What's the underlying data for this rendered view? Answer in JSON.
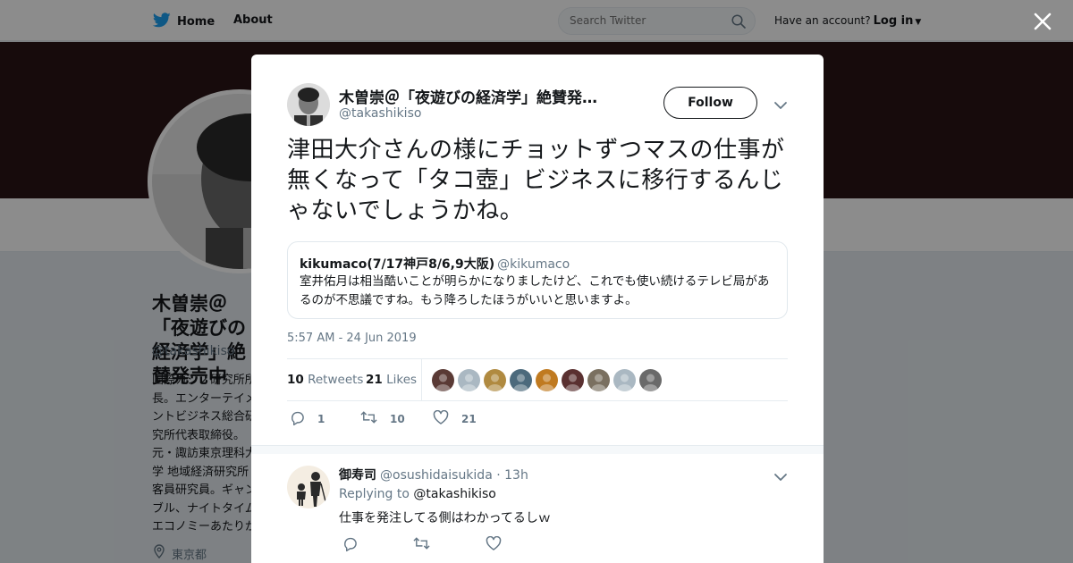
{
  "header": {
    "home_label": "Home",
    "about_label": "About",
    "search_placeholder": "Search Twitter",
    "have_account": "Have an account?",
    "login_label": "Log in",
    "icons": [
      "twitter-bird-icon",
      "search-icon",
      "caret-down-icon"
    ]
  },
  "profile": {
    "name": "木曽崇＠「夜遊びの経済学」絶賛発売中",
    "handle": "@takashikiso",
    "bio": "国際カジノ研究所所長。エンターテイメントビジネス総合研究所代表取締役。元・諏訪東京理科大学 地域経済研究所客員研究員。ギャンブル、ナイトタイムエコノミーあたりが守備範囲。著書に「日本版カジノのすべて」（日本実業出版社）、「夜遊びの経済学」（光文社新書）など。主にナイトタイムエコノミー関連の執筆活動など",
    "location": "東京都"
  },
  "tweet": {
    "author_name": "木曽崇＠「夜遊びの経済学」絶賛発…",
    "author_handle": "@takashikiso",
    "follow_label": "Follow",
    "text": "津田大介さんの様にチョットずつマスの仕事が無くなって「タコ壺」ビジネスに移行するんじゃないでしょうかね。",
    "timestamp": "5:57 AM - 24 Jun 2019",
    "quote": {
      "name": "kikumaco(7/17神戸8/6,9大阪)",
      "handle": "@kikumaco",
      "text": "室井佑月は相当酷いことが明らかになりましたけど、これでも使い続けるテレビ局があるのが不思議ですね。もう降ろしたほうがいいと思いますよ。"
    },
    "stats": {
      "retweets_count": "10",
      "retweets_label": "Retweets",
      "likes_count": "21",
      "likes_label": "Likes"
    },
    "actions": {
      "reply_count": "1",
      "retweet_count": "10",
      "like_count": "21"
    },
    "liker_colors": [
      "#5a3a35",
      "#aab8c2",
      "#b08a40",
      "#4c6a7c",
      "#c07a20",
      "#5a3030",
      "#7a7060",
      "#aab8c2",
      "#6a6a6a"
    ]
  },
  "reply": {
    "name": "御寿司",
    "handle": "@osushidaisukida",
    "time": "· 13h",
    "replying_to_label": "Replying to",
    "replying_to_handle": "@takashikiso",
    "text": "仕事を発注してる側はわかってるしｗ"
  },
  "colors": {
    "accent": "#1da1f2",
    "banner": "#2a1517",
    "text_primary": "#14171a",
    "text_secondary": "#657786",
    "overlay": "rgba(0,0,0,0.45)"
  }
}
